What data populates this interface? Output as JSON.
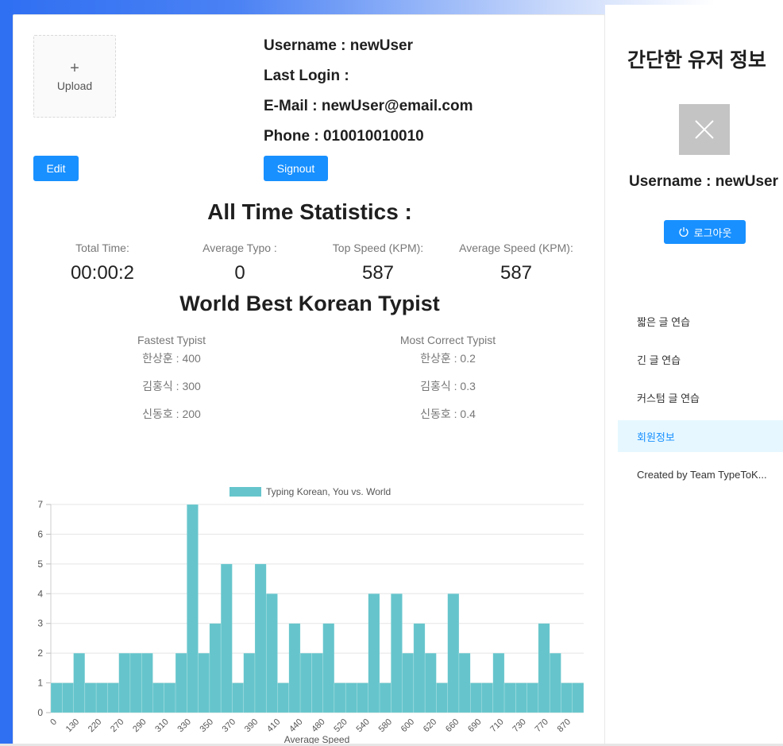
{
  "profile": {
    "upload_label": "Upload",
    "edit_label": "Edit",
    "signout_label": "Signout",
    "username_line": "Username : newUser",
    "last_login_line": "Last Login :",
    "email_line": "E-Mail : newUser@email.com",
    "phone_line": "Phone : 010010010010"
  },
  "stats": {
    "title": "All Time Statistics :",
    "items": [
      {
        "label": "Total Time:",
        "value": "00:00:2"
      },
      {
        "label": "Average Typo :",
        "value": "0"
      },
      {
        "label": "Top Speed (KPM):",
        "value": "587"
      },
      {
        "label": "Average Speed (KPM):",
        "value": "587"
      }
    ]
  },
  "world": {
    "title": "World Best Korean Typist",
    "fastest_title": "Fastest Typist",
    "fastest": [
      "한상훈 : 400",
      "김홍식 : 300",
      "신동호 : 200"
    ],
    "correct_title": "Most Correct Typist",
    "correct": [
      "한상훈 : 0.2",
      "김홍식 : 0.3",
      "신동호 : 0.4"
    ]
  },
  "chart_data": {
    "type": "bar",
    "legend": "Typing Korean, You vs. World",
    "xlabel": "Average Speed",
    "ylim": [
      0,
      7
    ],
    "yticks": [
      0,
      1,
      2,
      3,
      4,
      5,
      6,
      7
    ],
    "xtick_labels": [
      "0",
      "130",
      "220",
      "270",
      "290",
      "310",
      "330",
      "350",
      "370",
      "390",
      "410",
      "440",
      "480",
      "520",
      "540",
      "580",
      "600",
      "620",
      "660",
      "690",
      "710",
      "730",
      "770",
      "870"
    ],
    "values": [
      1,
      1,
      2,
      1,
      1,
      1,
      2,
      2,
      2,
      1,
      1,
      2,
      7,
      2,
      3,
      5,
      1,
      2,
      5,
      4,
      1,
      3,
      2,
      2,
      3,
      1,
      1,
      1,
      4,
      1,
      4,
      2,
      3,
      2,
      1,
      4,
      2,
      1,
      1,
      2,
      1,
      1,
      1,
      3,
      2,
      1,
      1
    ],
    "color": "#66c5cc",
    "grid": true,
    "legend_position": "top"
  },
  "sidebar": {
    "title": "간단한 유저 정보",
    "username_line": "Username : newUser",
    "logout_label": "로그아웃",
    "menu": [
      {
        "label": "짧은 글 연습"
      },
      {
        "label": "긴 글 연습"
      },
      {
        "label": "커스텀 글 연습"
      },
      {
        "label": "회원정보",
        "active": true
      },
      {
        "label": "Created by Team TypeToK..."
      }
    ]
  },
  "colors": {
    "primary": "#1890ff",
    "bar": "#66c5cc",
    "accent_bg": "#2f6ff2"
  }
}
